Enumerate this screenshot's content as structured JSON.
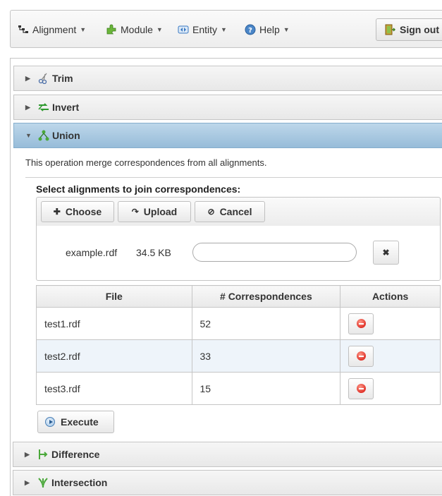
{
  "menubar": {
    "items": [
      {
        "label": "Alignment",
        "icon": "alignment-icon"
      },
      {
        "label": "Module",
        "icon": "puzzle-icon"
      },
      {
        "label": "Entity",
        "icon": "entity-icon"
      },
      {
        "label": "Help",
        "icon": "help-icon"
      }
    ],
    "sign_out_label": "Sign out"
  },
  "accordion": {
    "panels": [
      {
        "label": "Trim",
        "icon": "scissors-icon",
        "expanded": false
      },
      {
        "label": "Invert",
        "icon": "invert-icon",
        "expanded": false
      },
      {
        "label": "Union",
        "icon": "union-icon",
        "expanded": true
      },
      {
        "label": "Difference",
        "icon": "difference-icon",
        "expanded": false
      },
      {
        "label": "Intersection",
        "icon": "intersection-icon",
        "expanded": false
      }
    ]
  },
  "union": {
    "description": "This operation merge correspondences from all alignments.",
    "select_label": "Select alignments to join correspondences:",
    "upload": {
      "choose_label": "Choose",
      "upload_label": "Upload",
      "cancel_label": "Cancel",
      "pending_file": {
        "name": "example.rdf",
        "size": "34.5 KB",
        "progress": 0
      }
    },
    "table": {
      "headers": [
        "File",
        "# Correspondences",
        "Actions"
      ],
      "rows": [
        {
          "file": "test1.rdf",
          "count": "52"
        },
        {
          "file": "test2.rdf",
          "count": "33"
        },
        {
          "file": "test3.rdf",
          "count": "15"
        }
      ]
    },
    "execute_label": "Execute"
  },
  "colors": {
    "active_header": "#97bcd9",
    "alt_row": "#eef4fa",
    "remove_icon": "#e0332a"
  }
}
